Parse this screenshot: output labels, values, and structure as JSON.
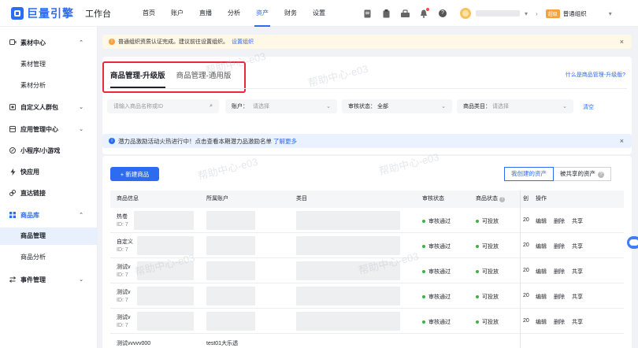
{
  "app": {
    "logo_text": "巨量引擎",
    "workbench": "工作台",
    "nav": [
      "首页",
      "账户",
      "直播",
      "分析",
      "资产",
      "财务",
      "设置"
    ],
    "nav_active_index": 4,
    "account_arrow": "▾",
    "account_sep": "›",
    "badge": "超级",
    "org_name": "普通组织",
    "org_arrow": "▾",
    "help_icon": "?",
    "accent_color": "#2d6cf0"
  },
  "sidebar": {
    "groups": [
      {
        "label": "素材中心",
        "icon": "video-icon",
        "caret": "⌃",
        "open": true
      },
      {
        "label": "自定义人群包",
        "icon": "crowd-icon",
        "caret": "⌄"
      },
      {
        "label": "应用管理中心",
        "icon": "app-icon",
        "caret": "⌄"
      },
      {
        "label": "小程序/小游戏",
        "icon": "miniapp-icon"
      },
      {
        "label": "快应用",
        "icon": "flash-icon"
      },
      {
        "label": "直达链接",
        "icon": "link-icon"
      },
      {
        "label": "商品库",
        "icon": "grid-icon",
        "caret": "⌃",
        "open": true
      },
      {
        "label": "事件管理",
        "icon": "event-icon",
        "caret": "⌄"
      }
    ],
    "sub_material": [
      "素材管理",
      "素材分析"
    ],
    "sub_product": [
      "商品管理",
      "商品分析"
    ],
    "active_sub": "商品管理"
  },
  "notice": {
    "icon": "!",
    "text": "普通组织资质认证完成。建议前往设置组织。",
    "link": "设置组织",
    "close": "×"
  },
  "tabs": {
    "items": [
      "商品管理-升级版",
      "商品管理-通用版"
    ],
    "active_index": 0,
    "help_link": "什么是商品管理-升级版?"
  },
  "filters": {
    "search_placeholder": "请输入商品名称或ID",
    "search_icon": "⌕",
    "account_label": "账户：",
    "account_placeholder": "请选择",
    "review_label": "审核状态：",
    "review_value": "全部",
    "category_label": "商品类目：",
    "category_placeholder": "请选择",
    "caret": "⌄",
    "clear": "清空"
  },
  "promo": {
    "icon": "i",
    "text": "潜力品激励活动火热进行中！点击查看本期潜力品激励名单",
    "link": "了解更多",
    "close": "×"
  },
  "toolbar": {
    "new_button": "+ 新建商品",
    "seg_mine": "我创建的资产",
    "seg_shared": "被共享的资产",
    "seg_help": "?"
  },
  "table": {
    "headers": [
      "商品信息",
      "所属账户",
      "类目",
      "审核状态",
      "商品状态",
      "创",
      "操作"
    ],
    "rows": [
      {
        "name": "热卷",
        "id": "ID: 7",
        "review": "审核通过",
        "status": "可投放",
        "date": "20"
      },
      {
        "name": "自定义",
        "id": "ID: 7",
        "review": "审核通过",
        "status": "可投放",
        "date": "20"
      },
      {
        "name": "测试v",
        "id": "ID: 7",
        "review": "审核通过",
        "status": "可投放",
        "date": "20"
      },
      {
        "name": "测试v",
        "id": "ID: 7",
        "review": "审核通过",
        "status": "可投放",
        "date": "20"
      },
      {
        "name": "测试v",
        "id": "ID: 7",
        "review": "审核通过",
        "status": "可投放",
        "date": "20"
      },
      {
        "name": "测试vvvvv000",
        "id": "",
        "review": "",
        "status": "",
        "date": "",
        "account": "test01大乐透"
      }
    ],
    "ops": [
      "编辑",
      "删除",
      "共享"
    ],
    "status_color": "#3bb346"
  },
  "watermark": "帮助中心-e03"
}
